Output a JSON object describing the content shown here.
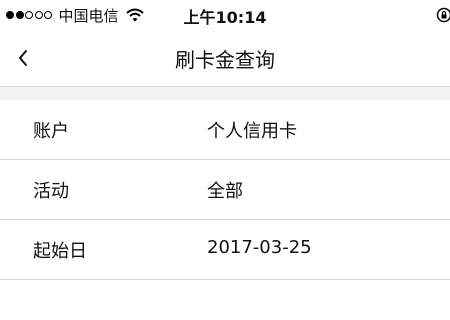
{
  "status_bar": {
    "carrier": "中国电信",
    "time": "上午10:14",
    "icons": [
      "signal-dots",
      "wifi-icon",
      "orientation-lock-icon"
    ]
  },
  "nav": {
    "back_icon": "chevron-left-icon",
    "title": "刷卡金查询"
  },
  "rows": [
    {
      "label": "账户",
      "value": "个人信用卡"
    },
    {
      "label": "活动",
      "value": "全部"
    },
    {
      "label": "起始日",
      "value": "2017-03-25"
    }
  ],
  "colors": {
    "background": "#ffffff",
    "separator": "#d9d9d9",
    "gap_background": "#f2f2f4",
    "text": "#111111"
  }
}
